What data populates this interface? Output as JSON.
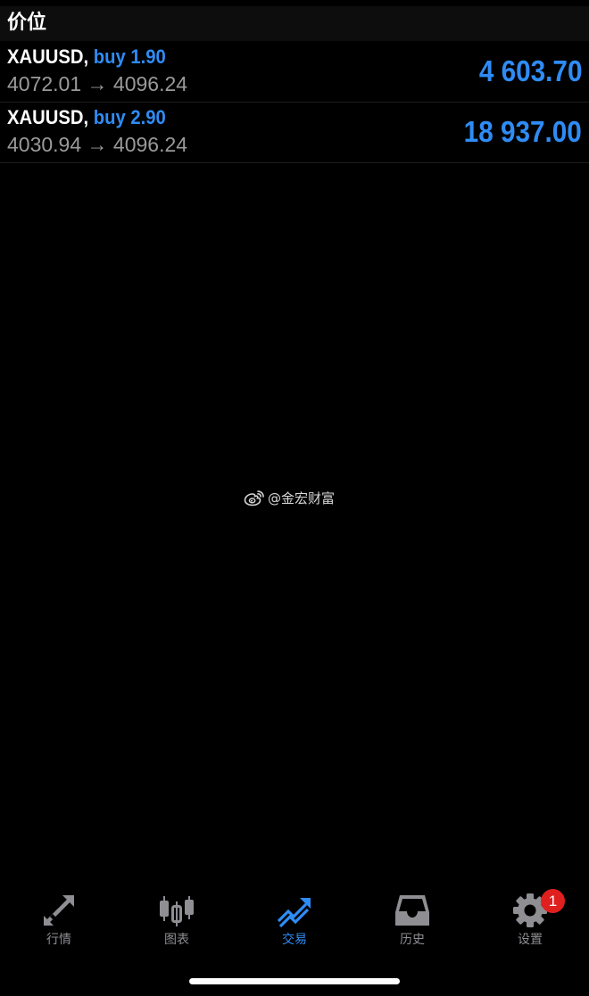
{
  "header": {
    "title": "价位"
  },
  "positions": [
    {
      "symbol": "XAUUSD,",
      "direction": "buy 1.90",
      "open_price": "4072.01",
      "arrow": "→",
      "current_price": "4096.24",
      "profit": "4 603.70"
    },
    {
      "symbol": "XAUUSD,",
      "direction": "buy 2.90",
      "open_price": "4030.94",
      "arrow": "→",
      "current_price": "4096.24",
      "profit": "18 937.00"
    }
  ],
  "watermark": {
    "text": "@金宏财富",
    "icon": "weibo-icon"
  },
  "tabs": [
    {
      "label": "行情",
      "icon": "quotes-arrows-icon",
      "active": false
    },
    {
      "label": "图表",
      "icon": "candlestick-chart-icon",
      "active": false
    },
    {
      "label": "交易",
      "icon": "trade-trend-icon",
      "active": true
    },
    {
      "label": "历史",
      "icon": "history-inbox-icon",
      "active": false
    },
    {
      "label": "设置",
      "icon": "gear-icon",
      "active": false
    }
  ],
  "settings_badge": "1",
  "colors": {
    "accent": "#2f8cf5",
    "inactive": "#8e8e93",
    "badge": "#e0201f",
    "background": "#000000"
  }
}
